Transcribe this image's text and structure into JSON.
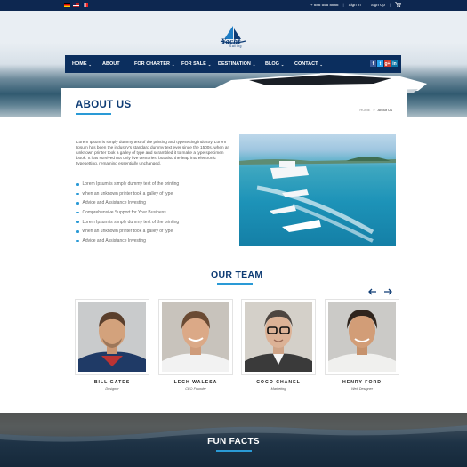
{
  "topbar": {
    "flags": [
      "flag-germany",
      "flag-usa",
      "flag-france"
    ],
    "phone": "+ 888 555 8888",
    "sign_in": "Sign In",
    "sign_up": "Sign Up",
    "separator": "|",
    "cart_icon": "cart-icon"
  },
  "logo": {
    "text": "Yacht",
    "sub": "Sailing"
  },
  "nav": {
    "items": [
      {
        "label": "HOME",
        "dropdown": true
      },
      {
        "label": "ABOUT",
        "dropdown": false
      },
      {
        "label": "FOR CHARTER",
        "dropdown": true
      },
      {
        "label": "FOR SALE",
        "dropdown": true
      },
      {
        "label": "DESTINATION",
        "dropdown": true
      },
      {
        "label": "BLOG",
        "dropdown": true
      },
      {
        "label": "CONTACT",
        "dropdown": true
      }
    ],
    "caret": "⌄",
    "social": [
      "f",
      "t",
      "g+",
      "in"
    ]
  },
  "page": {
    "title": "ABOUT US",
    "breadcrumb": {
      "home": "HOME",
      "separator": "»",
      "current": "About Us"
    }
  },
  "about": {
    "paragraph": "Lorem Ipsum is simply dummy text of the printing and typesetting industry. Lorem Ipsum has been the industry's standard dummy text ever since the 1500s, when an unknown printer took a galley of type and scrambled it to make a type specimen book. It has survived not only five centuries, but also the leap into electronic typesetting, remaining essentially unchanged.",
    "bullets": [
      "Lorem Ipsum is simply dummy text of the printing",
      "when an unknown printer took a galley of type",
      "Advice and Assistance Investing",
      "Comprehensive Support for Your Business",
      "Lorem Ipsum is simply dummy text of the printing",
      "when an unknown printer took a galley of type",
      "Advice and Assistance Investing"
    ]
  },
  "team": {
    "title": "OUR TEAM",
    "members": [
      {
        "name": "BILL GATES",
        "role": "Designer"
      },
      {
        "name": "LECH WALESA",
        "role": "CEO Founder"
      },
      {
        "name": "COCO CHANEL",
        "role": "Marketing"
      },
      {
        "name": "HENRY FORD",
        "role": "Web Designer"
      }
    ]
  },
  "facts": {
    "title": "FUN FACTS"
  },
  "colors": {
    "navy": "#0b2e5e",
    "title": "#0d3b74",
    "accent": "#2a9ad6"
  }
}
